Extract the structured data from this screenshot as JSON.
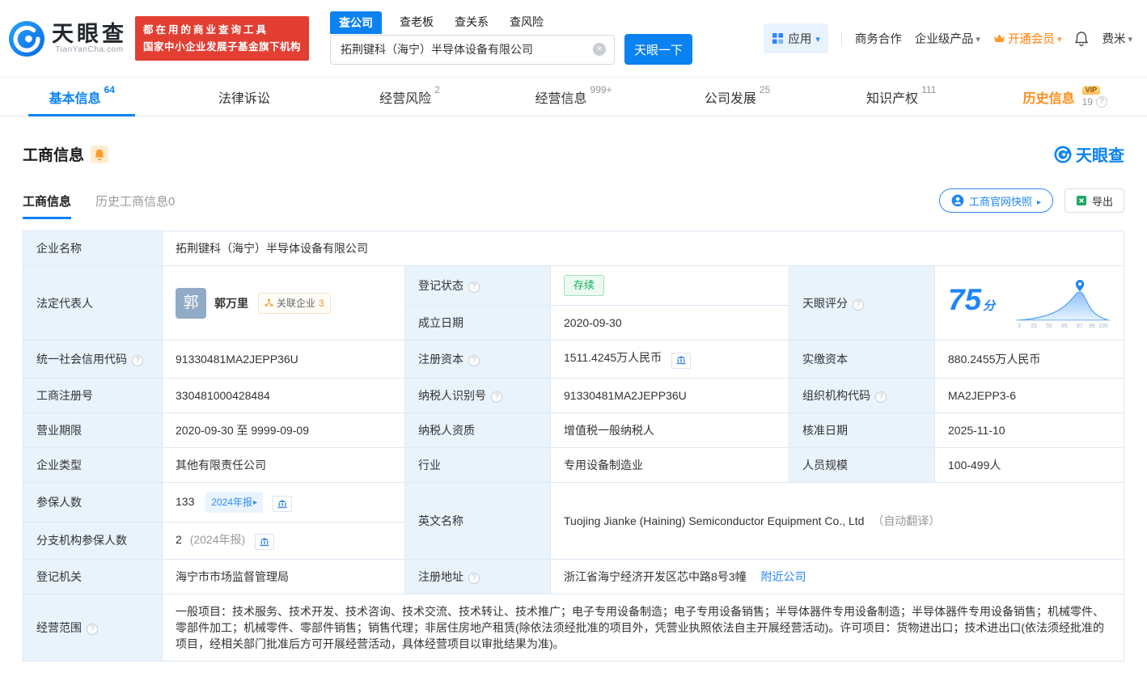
{
  "header": {
    "logo_cn": "天眼查",
    "logo_en": "TianYanCha.com",
    "slogan_line1": "都在用的商业查询工具",
    "slogan_line2": "国家中小企业发展子基金旗下机构",
    "search_tabs": [
      {
        "label": "查公司"
      },
      {
        "label": "查老板"
      },
      {
        "label": "查关系"
      },
      {
        "label": "查风险"
      }
    ],
    "search_value": "拓荆键科（海宁）半导体设备有限公司",
    "search_button": "天眼一下",
    "apps_label": "应用",
    "nav_links": [
      "商务合作",
      "企业级产品"
    ],
    "vip_label": "开通会员",
    "username": "费米"
  },
  "nav_tabs": [
    {
      "label": "基本信息",
      "count": "64"
    },
    {
      "label": "法律诉讼",
      "count": ""
    },
    {
      "label": "经营风险",
      "count": "2"
    },
    {
      "label": "经营信息",
      "count": "999+"
    },
    {
      "label": "公司发展",
      "count": "25"
    },
    {
      "label": "知识产权",
      "count": "111"
    },
    {
      "label": "历史信息",
      "count": "19",
      "vip_tag": "VIP"
    }
  ],
  "section": {
    "title": "工商信息",
    "brand": "天眼查",
    "tab_current": "工商信息",
    "tab_history": "历史工商信息0",
    "snapshot_button": "工商官网快照",
    "export_button": "导出"
  },
  "info": {
    "company_name": {
      "label": "企业名称",
      "value": "拓荆键科（海宁）半导体设备有限公司"
    },
    "legal_rep": {
      "label": "法定代表人",
      "avatar": "郭",
      "name": "郭万里",
      "related_label": "关联企业",
      "related_count": "3"
    },
    "reg_status": {
      "label": "登记状态",
      "value": "存续"
    },
    "establish_date": {
      "label": "成立日期",
      "value": "2020-09-30"
    },
    "score": {
      "label": "天眼评分",
      "value": "75",
      "unit": "分",
      "axis_ticks": [
        "3",
        "15",
        "55",
        "85",
        "97",
        "99",
        "100"
      ]
    },
    "credit_code": {
      "label": "统一社会信用代码",
      "value": "91330481MA2JEPP36U"
    },
    "reg_capital": {
      "label": "注册资本",
      "value": "1511.4245万人民币"
    },
    "paid_capital": {
      "label": "实缴资本",
      "value": "880.2455万人民币"
    },
    "reg_number": {
      "label": "工商注册号",
      "value": "330481000428484"
    },
    "taxpayer_id": {
      "label": "纳税人识别号",
      "value": "91330481MA2JEPP36U"
    },
    "org_code": {
      "label": "组织机构代码",
      "value": "MA2JEPP3-6"
    },
    "business_term": {
      "label": "营业期限",
      "value": "2020-09-30 至 9999-09-09"
    },
    "taxpayer_quality": {
      "label": "纳税人资质",
      "value": "增值税一般纳税人"
    },
    "approval_date": {
      "label": "核准日期",
      "value": "2025-11-10"
    },
    "company_type": {
      "label": "企业类型",
      "value": "其他有限责任公司"
    },
    "industry": {
      "label": "行业",
      "value": "专用设备制造业"
    },
    "staff_size": {
      "label": "人员规模",
      "value": "100-499人"
    },
    "insured_count": {
      "label": "参保人数",
      "value": "133",
      "badge": "2024年报"
    },
    "english_name": {
      "label": "英文名称",
      "value": "Tuojing Jianke (Haining) Semiconductor Equipment Co., Ltd",
      "note": "（自动翻译）"
    },
    "branch_insured": {
      "label": "分支机构参保人数",
      "value": "2",
      "badge": "(2024年报)"
    },
    "reg_authority": {
      "label": "登记机关",
      "value": "海宁市市场监督管理局"
    },
    "reg_address": {
      "label": "注册地址",
      "value": "浙江省海宁经济开发区芯中路8号3幢",
      "link": "附近公司"
    },
    "business_scope": {
      "label": "经营范围",
      "value": "一般项目：技术服务、技术开发、技术咨询、技术交流、技术转让、技术推广；电子专用设备制造；电子专用设备销售；半导体器件专用设备制造；半导体器件专用设备销售；机械零件、零部件加工；机械零件、零部件销售；销售代理；非居住房地产租赁(除依法须经批准的项目外，凭营业执照依法自主开展经营活动)。许可项目：货物进出口；技术进出口(依法须经批准的项目，经相关部门批准后方可开展经营活动，具体经营项目以审批结果为准)。"
    }
  }
}
